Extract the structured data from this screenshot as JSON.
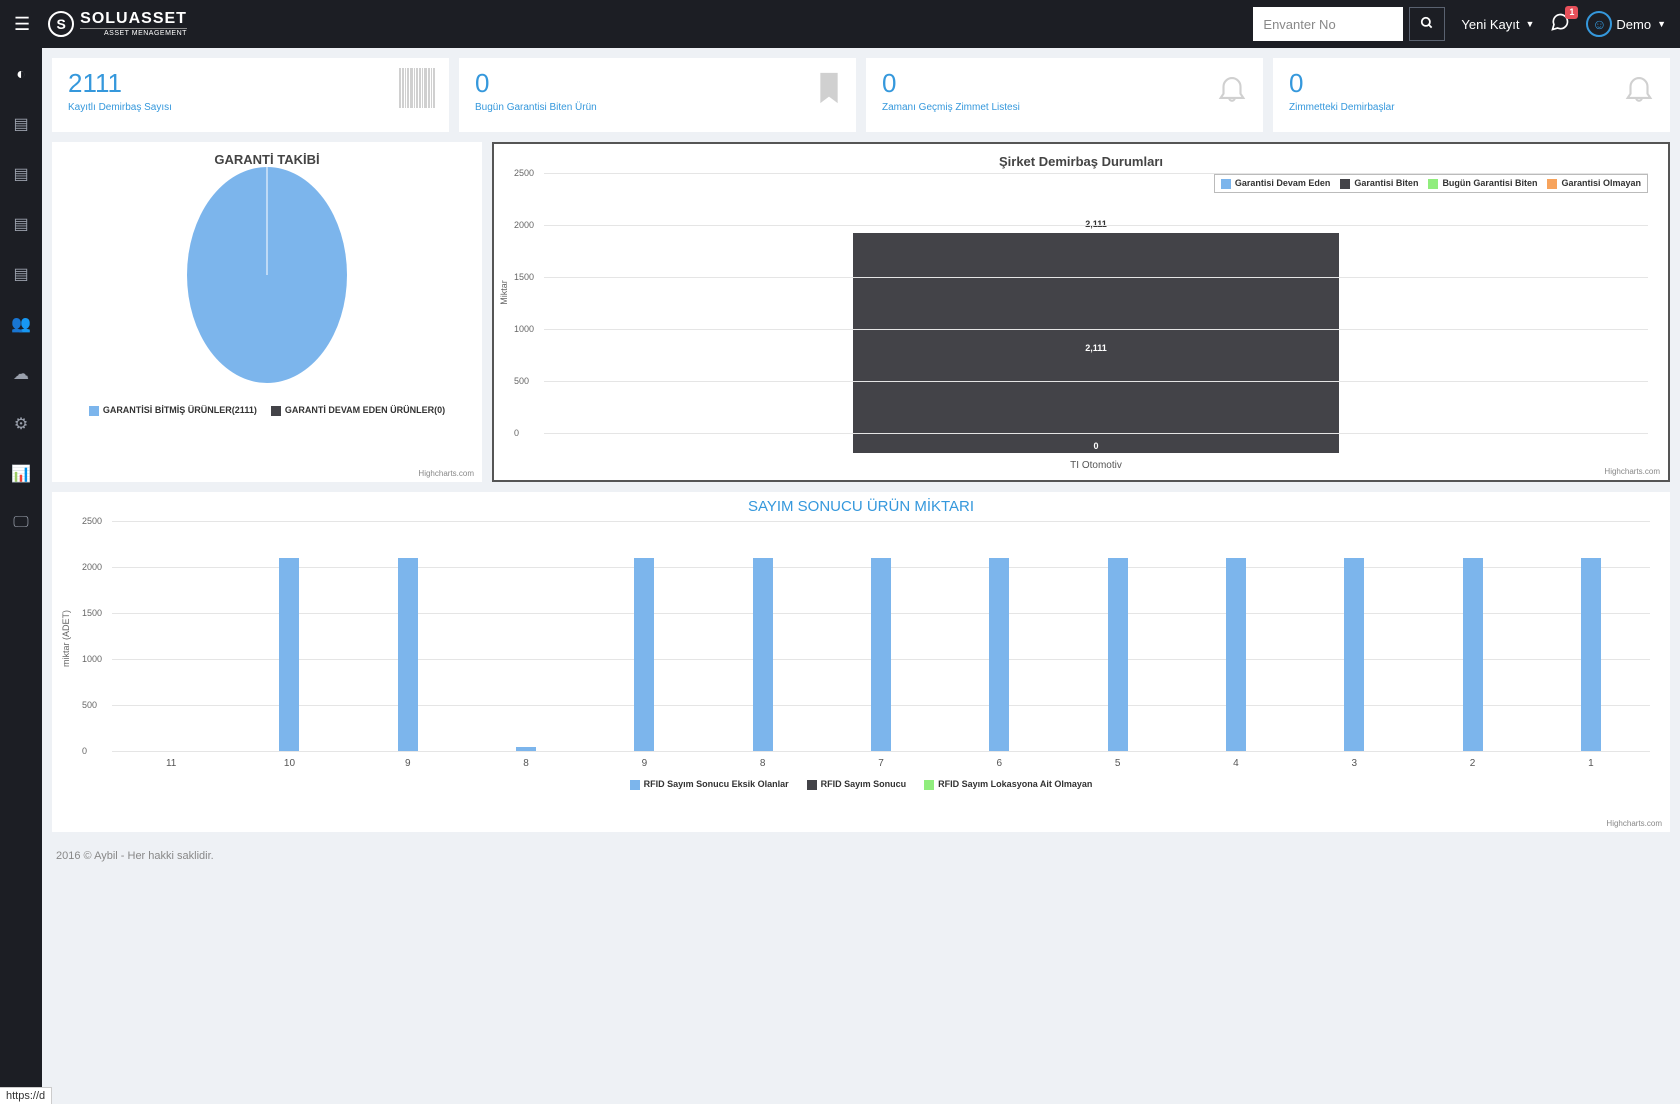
{
  "header": {
    "brand_name": "SOLUASSET",
    "brand_sub": "ASSET MENAGEMENT",
    "search_placeholder": "Envanter No",
    "new_record": "Yeni Kayıt",
    "notif_badge": "1",
    "user_name": "Demo"
  },
  "cards": [
    {
      "value": "2111",
      "label": "Kayıtlı Demirbaş Sayısı"
    },
    {
      "value": "0",
      "label": "Bugün Garantisi Biten Ürün"
    },
    {
      "value": "0",
      "label": "Zamanı Geçmiş Zimmet Listesi"
    },
    {
      "value": "0",
      "label": "Zimmetteki Demirbaşlar"
    }
  ],
  "pie": {
    "title": "GARANTİ TAKİBİ",
    "legend_a": "GARANTİSİ BİTMİŞ ÜRÜNLER(2111)",
    "legend_b": "GARANTİ DEVAM EDEN ÜRÜNLER(0)"
  },
  "stack": {
    "title": "Şirket Demirbaş Durumları",
    "ylabel": "Miktar",
    "xcat": "TI Otomotiv",
    "top_val": "2,111",
    "mid_val": "2,111",
    "bot_val": "0",
    "legend": {
      "a": "Garantisi Devam Eden",
      "b": "Garantisi Biten",
      "c": "Bugün Garantisi Biten",
      "d": "Garantisi Olmayan"
    },
    "ticks": [
      "0",
      "500",
      "1000",
      "1500",
      "2000",
      "2500"
    ]
  },
  "col": {
    "title": "SAYIM SONUCU ÜRÜN MİKTARI",
    "ylabel": "miktar (ADET)",
    "ticks": [
      "0",
      "500",
      "1000",
      "1500",
      "2000",
      "2500"
    ],
    "legend": {
      "a": "RFID Sayım Sonucu Eksik Olanlar",
      "b": "RFID Sayım Sonucu",
      "c": "RFID Sayım Lokasyona Ait Olmayan"
    }
  },
  "credits": "Highcharts.com",
  "footer": "2016 © Aybil - Her hakki saklidir.",
  "status": "https://d",
  "chart_data": [
    {
      "type": "pie",
      "title": "GARANTİ TAKİBİ",
      "series": [
        {
          "name": "GARANTİSİ BİTMİŞ ÜRÜNLER",
          "value": 2111
        },
        {
          "name": "GARANTİ DEVAM EDEN ÜRÜNLER",
          "value": 0
        }
      ]
    },
    {
      "type": "bar",
      "title": "Şirket Demirbaş Durumları",
      "stacked": true,
      "categories": [
        "TI Otomotiv"
      ],
      "ylabel": "Miktar",
      "ylim": [
        0,
        2500
      ],
      "series": [
        {
          "name": "Garantisi Devam Eden",
          "values": [
            0
          ]
        },
        {
          "name": "Garantisi Biten",
          "values": [
            2111
          ]
        },
        {
          "name": "Bugün Garantisi Biten",
          "values": [
            0
          ]
        },
        {
          "name": "Garantisi Olmayan",
          "values": [
            0
          ]
        }
      ]
    },
    {
      "type": "bar",
      "title": "SAYIM SONUCU ÜRÜN MİKTARI",
      "ylabel": "miktar (ADET)",
      "ylim": [
        0,
        2500
      ],
      "categories": [
        "11",
        "10",
        "9",
        "8",
        "9",
        "8",
        "7",
        "6",
        "5",
        "4",
        "3",
        "2",
        "1"
      ],
      "series": [
        {
          "name": "RFID Sayım Sonucu Eksik Olanlar",
          "values": [
            0,
            2100,
            2100,
            40,
            2100,
            2100,
            2100,
            2100,
            2100,
            2100,
            2100,
            2100,
            2100
          ]
        },
        {
          "name": "RFID Sayım Sonucu",
          "values": [
            0,
            0,
            0,
            0,
            0,
            0,
            0,
            0,
            0,
            0,
            0,
            0,
            0
          ]
        },
        {
          "name": "RFID Sayım Lokasyona Ait Olmayan",
          "values": [
            0,
            0,
            0,
            0,
            0,
            0,
            0,
            0,
            0,
            0,
            0,
            0,
            0
          ]
        }
      ]
    }
  ]
}
